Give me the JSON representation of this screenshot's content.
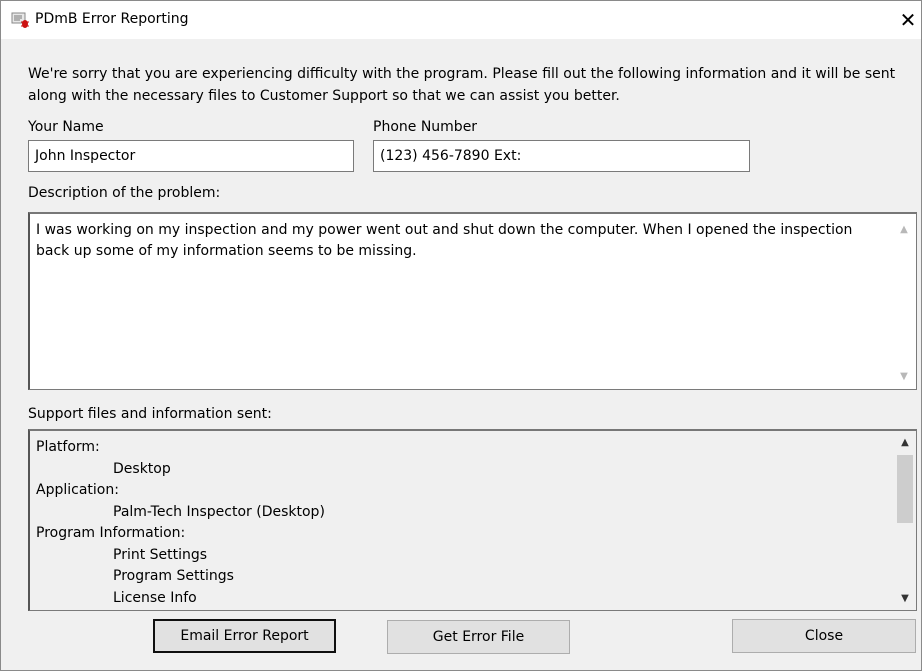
{
  "window": {
    "title": "PDmB Error Reporting",
    "close_glyph": "✕",
    "icon": "bug-report-icon"
  },
  "intro_text": "We're sorry that you are experiencing difficulty with the program. Please fill out the following information and it will be sent along with the necessary files to Customer Support so that we can assist you better.",
  "form": {
    "name_label": "Your Name",
    "name_value": "John Inspector",
    "phone_label": "Phone Number",
    "phone_value": "(123) 456-7890 Ext:",
    "description_label": "Description of the problem:",
    "description_value": "I was working on my inspection and my power went out and shut down the computer. When I opened the inspection back up some of my information seems to be missing."
  },
  "support": {
    "label": "Support files and information sent:",
    "lines": [
      {
        "text": "Platform:",
        "indent": false
      },
      {
        "text": "Desktop",
        "indent": true
      },
      {
        "text": "Application:",
        "indent": false
      },
      {
        "text": "Palm-Tech Inspector (Desktop)",
        "indent": true
      },
      {
        "text": "Program Information:",
        "indent": false
      },
      {
        "text": "Print Settings",
        "indent": true
      },
      {
        "text": "Program Settings",
        "indent": true
      },
      {
        "text": "License Info",
        "indent": true
      }
    ]
  },
  "buttons": {
    "email": "Email Error Report",
    "get_file": "Get Error File",
    "close": "Close"
  }
}
